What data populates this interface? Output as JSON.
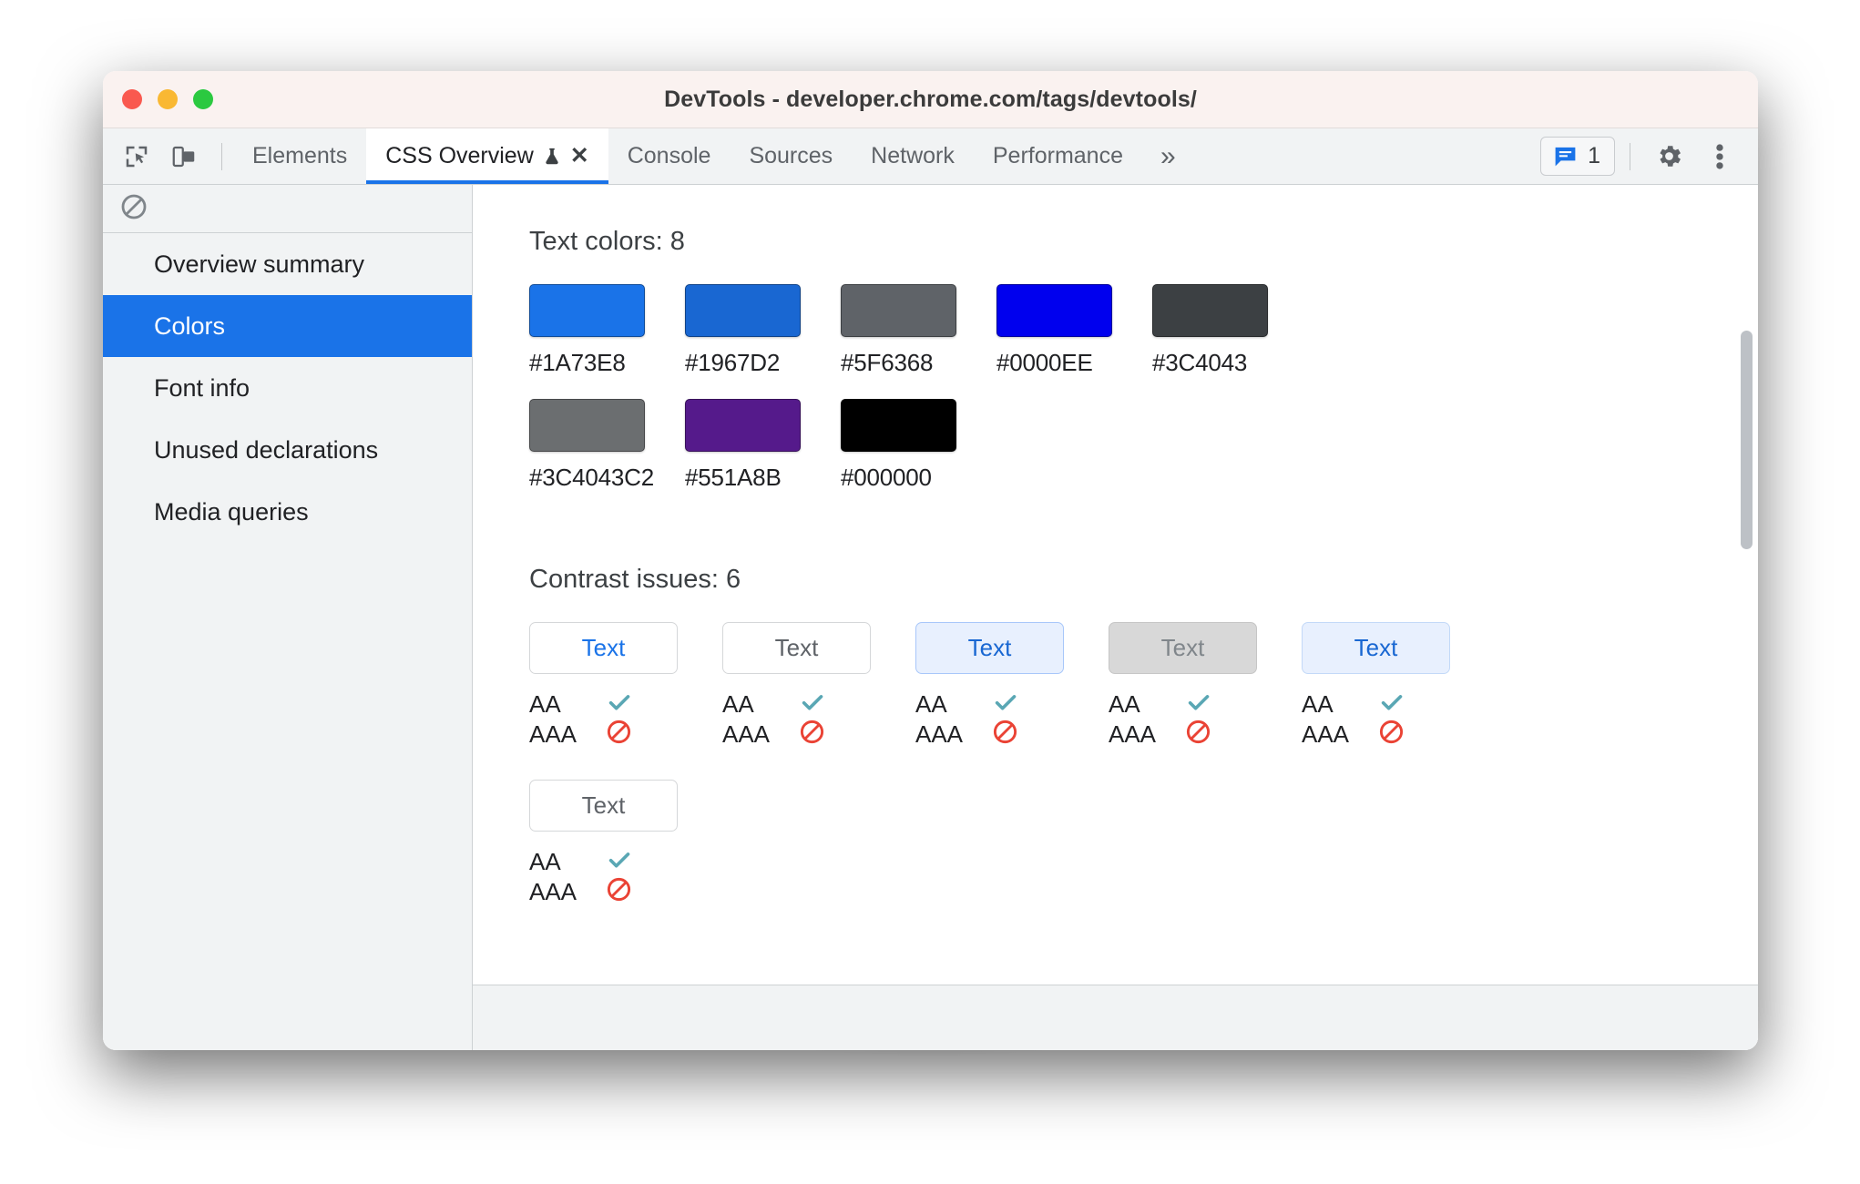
{
  "window": {
    "title": "DevTools - developer.chrome.com/tags/devtools/",
    "traffic_lights": [
      "close-red",
      "minimize-yellow",
      "zoom-green"
    ]
  },
  "toolbar": {
    "inspect_icon": "inspect-cursor-icon",
    "device_icon": "device-toolbar-icon",
    "overflow_label": "»",
    "issues_icon": "issues-message-icon",
    "issues_count": "1",
    "settings_icon": "gear-icon",
    "more_icon": "kebab-menu-icon"
  },
  "tabs": [
    {
      "label": "Elements",
      "active": false,
      "experimental": false,
      "closable": false
    },
    {
      "label": "CSS Overview",
      "active": true,
      "experimental": true,
      "closable": true,
      "close_label": "✕"
    },
    {
      "label": "Console",
      "active": false,
      "experimental": false,
      "closable": false
    },
    {
      "label": "Sources",
      "active": false,
      "experimental": false,
      "closable": false
    },
    {
      "label": "Network",
      "active": false,
      "experimental": false,
      "closable": false
    },
    {
      "label": "Performance",
      "active": false,
      "experimental": false,
      "closable": false
    }
  ],
  "sidebar": {
    "clear_icon": "clear-overview-icon",
    "items": [
      {
        "label": "Overview summary",
        "selected": false
      },
      {
        "label": "Colors",
        "selected": true
      },
      {
        "label": "Font info",
        "selected": false
      },
      {
        "label": "Unused declarations",
        "selected": false
      },
      {
        "label": "Media queries",
        "selected": false
      }
    ],
    "selected_bg": "#1A73E8"
  },
  "main": {
    "text_colors": {
      "heading": "Text colors: 8",
      "count": 8,
      "swatches": [
        {
          "label": "#1A73E8",
          "color": "#1A73E8"
        },
        {
          "label": "#1967D2",
          "color": "#1967D2"
        },
        {
          "label": "#5F6368",
          "color": "#5F6368"
        },
        {
          "label": "#0000EE",
          "color": "#0000EE"
        },
        {
          "label": "#3C4043",
          "color": "#3C4043"
        },
        {
          "label": "#3C4043C2",
          "color": "#3C4043C2"
        },
        {
          "label": "#551A8B",
          "color": "#551A8B"
        },
        {
          "label": "#000000",
          "color": "#000000"
        }
      ]
    },
    "contrast": {
      "heading": "Contrast issues: 6",
      "count": 6,
      "aa_label": "AA",
      "aaa_label": "AAA",
      "pass_icon": "checkmark-icon",
      "fail_icon": "no-entry-icon",
      "pass_color": "#5AA7B4",
      "fail_color": "#EA4335",
      "issues": [
        {
          "text": "Text",
          "text_color": "#1A73E8",
          "bg": "#FFFFFF",
          "border": "#D5D7D9",
          "aa": "pass",
          "aaa": "fail"
        },
        {
          "text": "Text",
          "text_color": "#5F6368",
          "bg": "#FFFFFF",
          "border": "#D5D7D9",
          "aa": "pass",
          "aaa": "fail"
        },
        {
          "text": "Text",
          "text_color": "#1967D2",
          "bg": "#E8F0FE",
          "border": "#A8C7FA",
          "aa": "pass",
          "aaa": "fail"
        },
        {
          "text": "Text",
          "text_color": "#80868B",
          "bg": "#D8D8D8",
          "border": "#C6C6C6",
          "aa": "pass",
          "aaa": "fail"
        },
        {
          "text": "Text",
          "text_color": "#1967D2",
          "bg": "#E8F0FE",
          "border": "#C3D9F8",
          "aa": "pass",
          "aaa": "fail"
        },
        {
          "text": "Text",
          "text_color": "#5F6368",
          "bg": "#FFFFFF",
          "border": "#D5D7D9",
          "aa": "pass",
          "aaa": "fail"
        }
      ]
    }
  }
}
